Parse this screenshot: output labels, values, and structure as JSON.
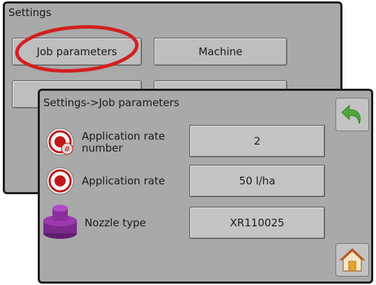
{
  "background_panel": {
    "title": "Settings",
    "buttons": [
      "Job parameters",
      "Machine"
    ]
  },
  "job_panel": {
    "title": "Settings->Job parameters",
    "rows": [
      {
        "label": "Application rate number",
        "value": "2",
        "icon": "application-rate-number-icon"
      },
      {
        "label": "Application rate",
        "value": "50 l/ha",
        "icon": "application-rate-icon"
      },
      {
        "label": "Nozzle type",
        "value": "XR110025",
        "icon": "nozzle-icon"
      }
    ],
    "back_icon": "back-arrow-icon",
    "home_icon": "home-icon"
  },
  "colors": {
    "panel": "#a9a9a9",
    "border": "#1c1c1c",
    "highlight": "#d32020",
    "back_arrow": "#4fa83a",
    "nozzle": "#7a2a8a"
  }
}
